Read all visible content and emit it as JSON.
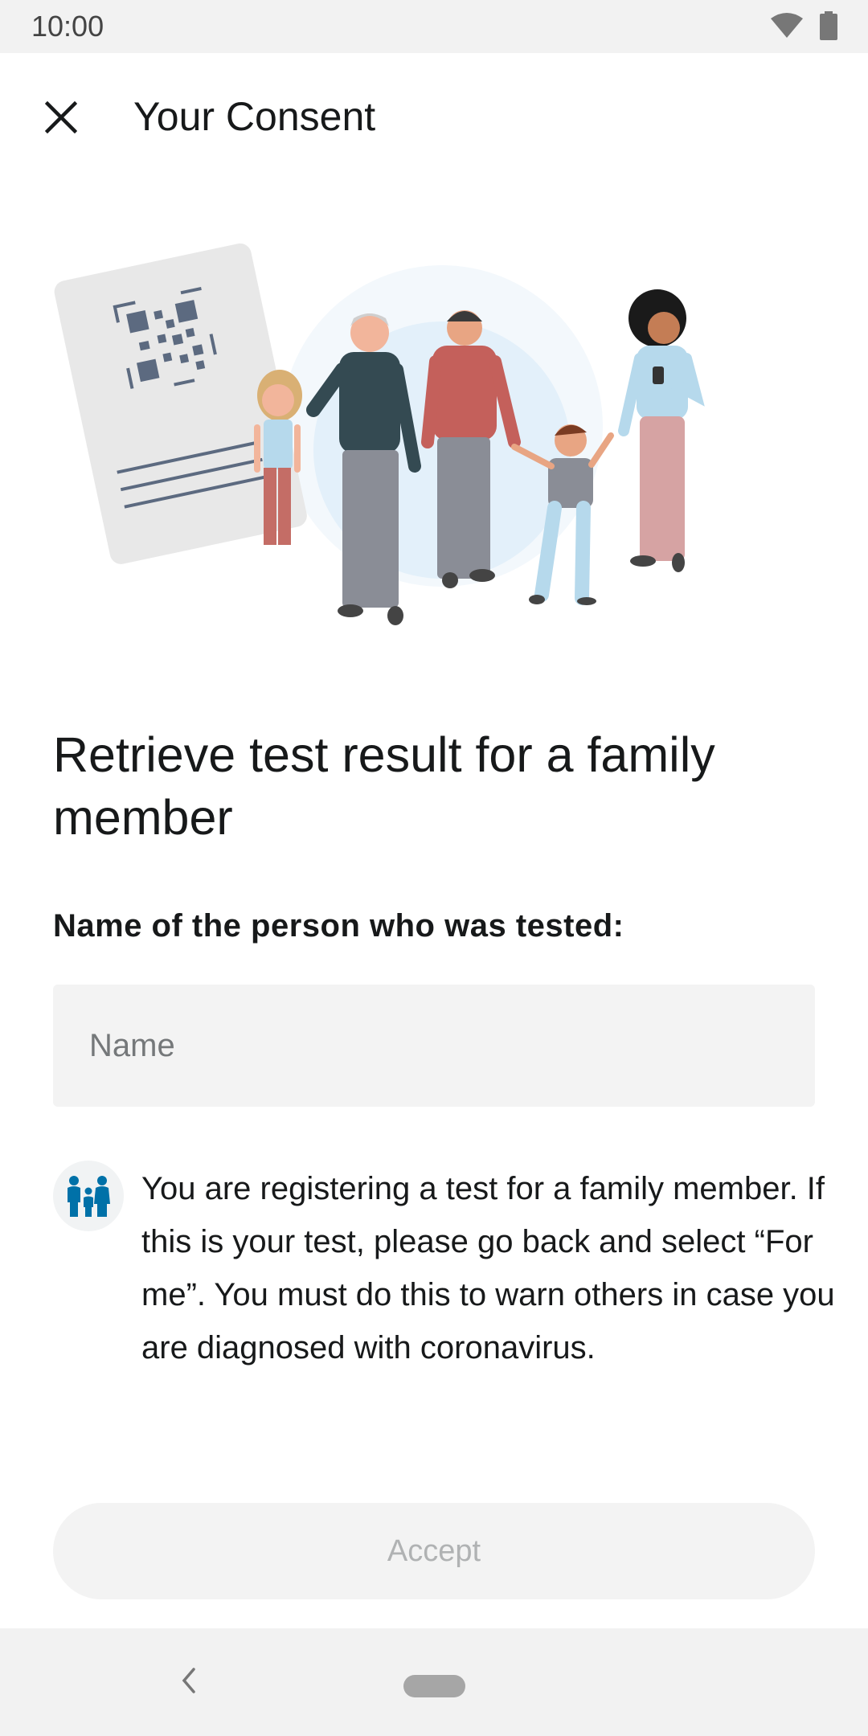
{
  "status_bar": {
    "time": "10:00",
    "icons": [
      "wifi-icon",
      "battery-icon"
    ]
  },
  "app_bar": {
    "title": "Your Consent",
    "close_icon": "close-icon"
  },
  "illustration": {
    "description_icon": "family-qr-illustration"
  },
  "main": {
    "headline": "Retrieve test result for a family member",
    "field_label": "Name of the person who was tested:",
    "name_input": {
      "placeholder": "Name",
      "value": ""
    },
    "info": {
      "icon": "family-icon",
      "text": "You are registering a test for a family member. If this is your test, please go back and select “For me”. You must do this to warn others in case you are diagnosed with coronavirus."
    },
    "accept_label": "Accept"
  },
  "colors": {
    "accent": "#0071a8",
    "disabled_text": "#b0b2b3",
    "surface": "#f3f3f3"
  },
  "nav_bar": {
    "back_icon": "nav-back-icon",
    "home_icon": "nav-home-pill"
  }
}
